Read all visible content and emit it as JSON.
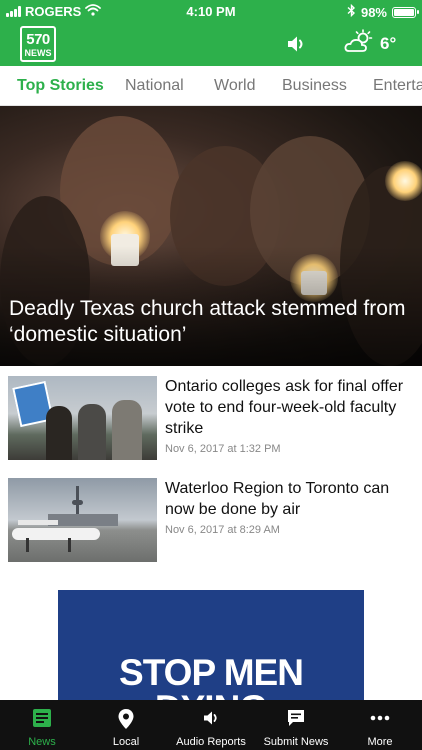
{
  "status_bar": {
    "carrier": "ROGERS",
    "time": "4:10 PM",
    "battery_percent": "98%",
    "battery_level": 0.98,
    "icons": [
      "signal-icon",
      "wifi-icon",
      "bluetooth-icon",
      "battery-icon"
    ]
  },
  "header": {
    "logo_number": "570",
    "logo_word": "NEWS",
    "temperature": "6°",
    "icons": [
      "speaker-icon",
      "weather-partly-sunny-icon"
    ],
    "brand_color": "#2db04b"
  },
  "tabs": [
    {
      "label": "Top Stories",
      "active": true
    },
    {
      "label": "National",
      "active": false
    },
    {
      "label": "World",
      "active": false
    },
    {
      "label": "Business",
      "active": false
    },
    {
      "label": "Entertainment",
      "active": false
    }
  ],
  "hero": {
    "headline": "Deadly Texas church attack stemmed from ‘domestic situation’"
  },
  "stories": [
    {
      "headline": "Ontario colleges ask for final offer vote to end four-week-old faculty strike",
      "date": "Nov 6, 2017 at 1:32 PM"
    },
    {
      "headline": "Waterloo Region to Toronto can now be done by air",
      "date": "Nov 6, 2017 at 8:29 AM"
    }
  ],
  "ad": {
    "line1": "STOP MEN",
    "line2": "DYING",
    "color": "#1f3f86"
  },
  "bottom_nav": [
    {
      "label": "News",
      "icon": "news-icon",
      "active": true
    },
    {
      "label": "Local",
      "icon": "location-pin-icon",
      "active": false
    },
    {
      "label": "Audio Reports",
      "icon": "speaker-icon",
      "active": false
    },
    {
      "label": "Submit News",
      "icon": "chat-bubble-icon",
      "active": false
    },
    {
      "label": "More",
      "icon": "more-dots-icon",
      "active": false
    }
  ]
}
